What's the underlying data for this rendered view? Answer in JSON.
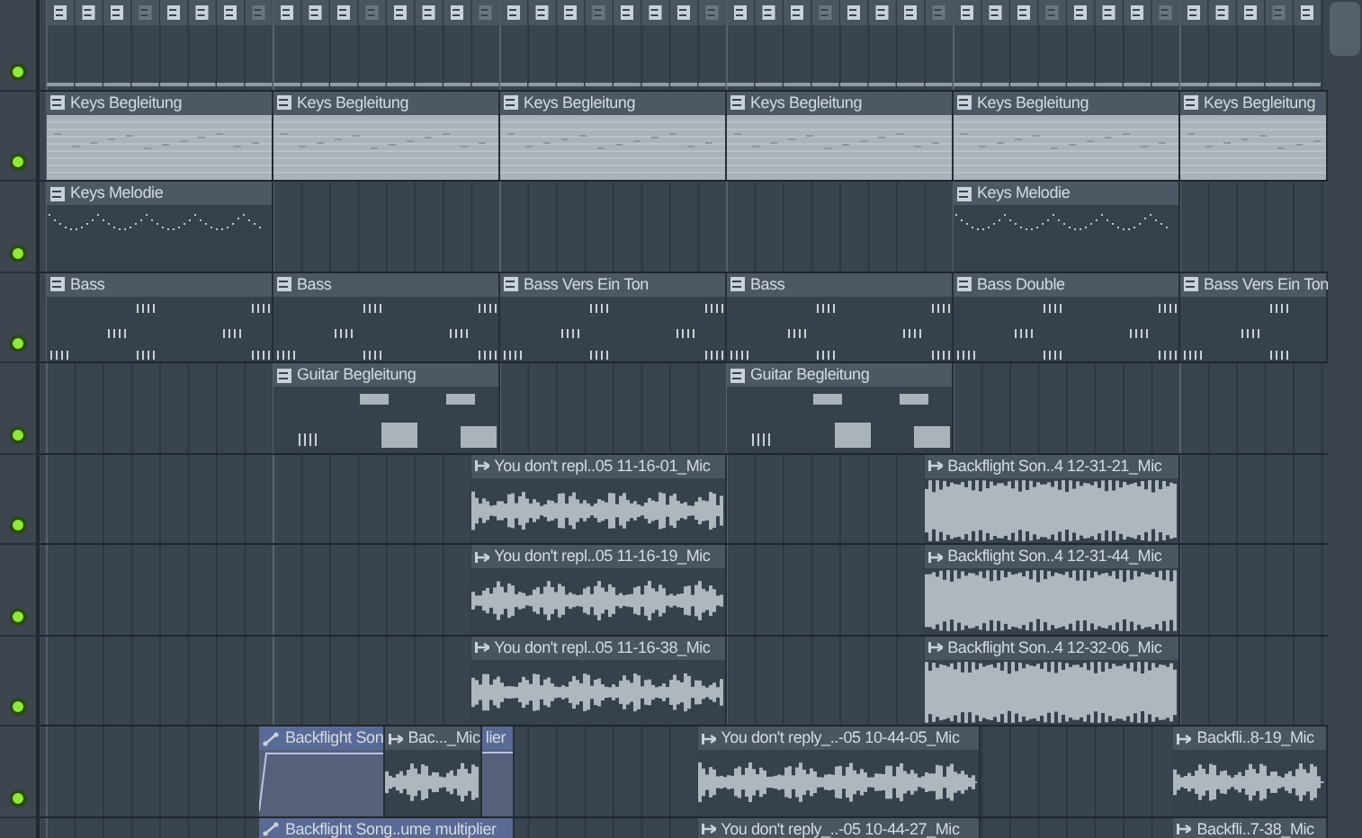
{
  "tracks": [
    {
      "enabled": true
    },
    {
      "enabled": true,
      "clips": [
        {
          "kind": "pattern",
          "name": "Keys Begleitung"
        },
        {
          "kind": "pattern",
          "name": "Keys Begleitung"
        },
        {
          "kind": "pattern",
          "name": "Keys Begleitung"
        },
        {
          "kind": "pattern",
          "name": "Keys Begleitung"
        },
        {
          "kind": "pattern",
          "name": "Keys Begleitung"
        },
        {
          "kind": "pattern",
          "name": "Keys Begleitung"
        }
      ]
    },
    {
      "enabled": true,
      "clips": [
        {
          "kind": "pattern",
          "name": "Keys Melodie"
        },
        {
          "kind": "pattern",
          "name": "Keys Melodie"
        }
      ]
    },
    {
      "enabled": true,
      "clips": [
        {
          "kind": "pattern",
          "name": "Bass"
        },
        {
          "kind": "pattern",
          "name": "Bass"
        },
        {
          "kind": "pattern",
          "name": "Bass Vers Ein Ton"
        },
        {
          "kind": "pattern",
          "name": "Bass"
        },
        {
          "kind": "pattern",
          "name": "Bass Double"
        },
        {
          "kind": "pattern",
          "name": "Bass Vers Ein Ton"
        }
      ]
    },
    {
      "enabled": true,
      "clips": [
        {
          "kind": "pattern",
          "name": "Guitar Begleitung"
        },
        {
          "kind": "pattern",
          "name": "Guitar Begleitung"
        }
      ]
    },
    {
      "enabled": true,
      "clips": [
        {
          "kind": "audio",
          "name": "You don't repl..05 11-16-01_Mic"
        },
        {
          "kind": "audio",
          "name": "Backflight Son..4 12-31-21_Mic"
        }
      ]
    },
    {
      "enabled": true,
      "clips": [
        {
          "kind": "audio",
          "name": "You don't repl..05 11-16-19_Mic"
        },
        {
          "kind": "audio",
          "name": "Backflight Son..4 12-31-44_Mic"
        }
      ]
    },
    {
      "enabled": true,
      "clips": [
        {
          "kind": "audio",
          "name": "You don't repl..05 11-16-38_Mic"
        },
        {
          "kind": "audio",
          "name": "Backflight Son..4 12-32-06_Mic"
        }
      ]
    },
    {
      "enabled": true,
      "clips": [
        {
          "kind": "automation",
          "name": "Backflight Son"
        },
        {
          "kind": "audio",
          "name": "Bac..._Mic"
        },
        {
          "kind": "automation",
          "name": "lier"
        },
        {
          "kind": "audio",
          "name": "You don't reply_..-05 10-44-05_Mic"
        },
        {
          "kind": "audio",
          "name": "Backfli..8-19_Mic"
        }
      ]
    },
    {
      "clips": [
        {
          "kind": "automation",
          "name": "Backflight Song..ume multiplier"
        },
        {
          "kind": "audio",
          "name": "You don't reply_..-05 10-44-27_Mic"
        },
        {
          "kind": "audio",
          "name": "Backfli..7-38_Mic"
        }
      ]
    }
  ]
}
